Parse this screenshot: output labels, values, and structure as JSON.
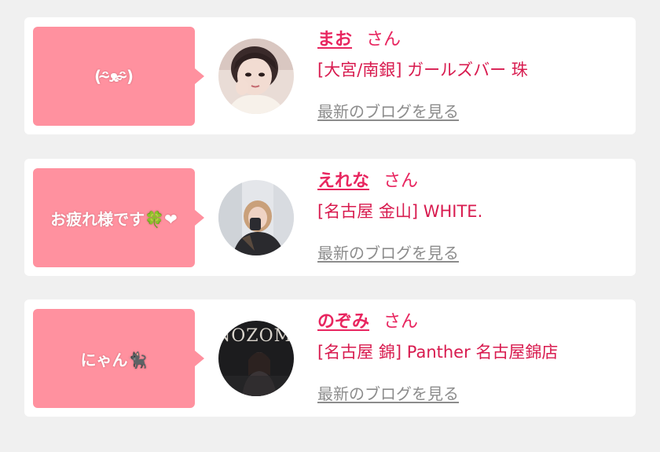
{
  "colors": {
    "page_bg": "#f0f0f0",
    "card_bg": "#ffffff",
    "bubble_pink": "#ff919f",
    "name_pink": "#e8255f",
    "shop_pink": "#d81b4f",
    "link_gray": "#8c8c8c"
  },
  "cards": [
    {
      "message": "(ᵔ̴ᴥ̴ᵔ̴)",
      "name": "まお",
      "suffix": "さん",
      "shop": "[大宮/南銀] ガールズバー 珠",
      "blog_link": "最新のブログを見る",
      "avatar_icon": "profile-photo"
    },
    {
      "message": "お疲れ様です🍀❤",
      "name": "えれな",
      "suffix": "さん",
      "shop": "[名古屋 金山] WHITE.",
      "blog_link": "最新のブログを見る",
      "avatar_icon": "profile-photo"
    },
    {
      "message": "にゃん🐈‍⬛",
      "name": "のぞみ",
      "suffix": "さん",
      "shop": "[名古屋 錦] Panther 名古屋錦店",
      "blog_link": "最新のブログを見る",
      "avatar_icon": "profile-photo",
      "avatar_text": "NOZOMI"
    }
  ]
}
